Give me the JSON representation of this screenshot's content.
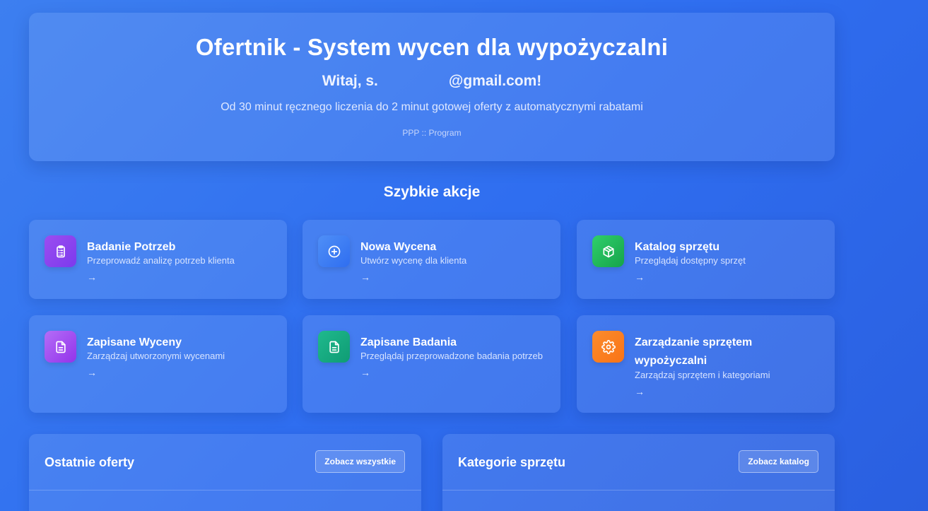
{
  "hero": {
    "title": "Ofertnik - System wycen dla wypożyczalni",
    "welcome_prefix": "Witaj, s.",
    "welcome_suffix": "@gmail.com!",
    "subtitle": "Od 30 minut ręcznego liczenia do 2 minut gotowej oferty z automatycznymi rabatami",
    "tagline": "PPP :: Program"
  },
  "quick_actions": {
    "title": "Szybkie akcje",
    "arrow": "→",
    "cards": [
      {
        "title": "Badanie Potrzeb",
        "desc": "Przeprowadź analizę potrzeb klienta",
        "icon": "clipboard-list-icon",
        "color": "#8b3fe0"
      },
      {
        "title": "Nowa Wycena",
        "desc": "Utwórz wycenę dla klienta",
        "icon": "plus-circle-icon",
        "color": "#3b82f6"
      },
      {
        "title": "Katalog sprzętu",
        "desc": "Przeglądaj dostępny sprzęt",
        "icon": "package-icon",
        "color": "#22c55e"
      },
      {
        "title": "Zapisane Wyceny",
        "desc": "Zarządzaj utworzonymi wycenami",
        "icon": "file-text-icon",
        "color": "#a855f7"
      },
      {
        "title": "Zapisane Badania",
        "desc": "Przeglądaj przeprowadzone badania potrzeb",
        "icon": "file-text-icon",
        "color": "#10a37f"
      },
      {
        "title": "Zarządzanie sprzętem wypożyczalni",
        "desc": "Zarządzaj sprzętem i kategoriami",
        "icon": "gear-icon",
        "color": "#f97316"
      }
    ]
  },
  "recent_offers": {
    "title": "Ostatnie oferty",
    "button": "Zobacz wszystkie"
  },
  "categories": {
    "title": "Kategorie sprzętu",
    "button": "Zobacz katalog"
  }
}
